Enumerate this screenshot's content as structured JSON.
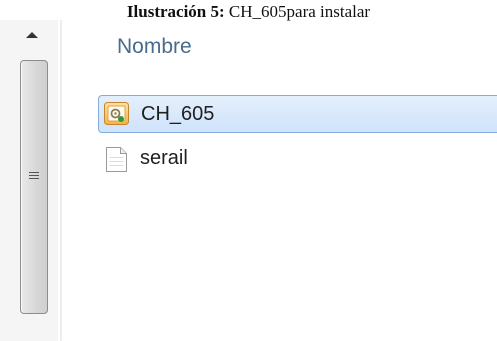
{
  "caption": {
    "bold": "Ilustración 5:",
    "text": " CH_605para instalar"
  },
  "list": {
    "column_header": "Nombre",
    "items": [
      {
        "name": "CH_605",
        "icon": "setup-installer-icon",
        "selected": true
      },
      {
        "name": "serail",
        "icon": "text-document-icon",
        "selected": false
      }
    ]
  },
  "colors": {
    "selection_fill": "#cfe3fb",
    "selection_border": "#84acdd",
    "header_text": "#4a6a8e"
  }
}
